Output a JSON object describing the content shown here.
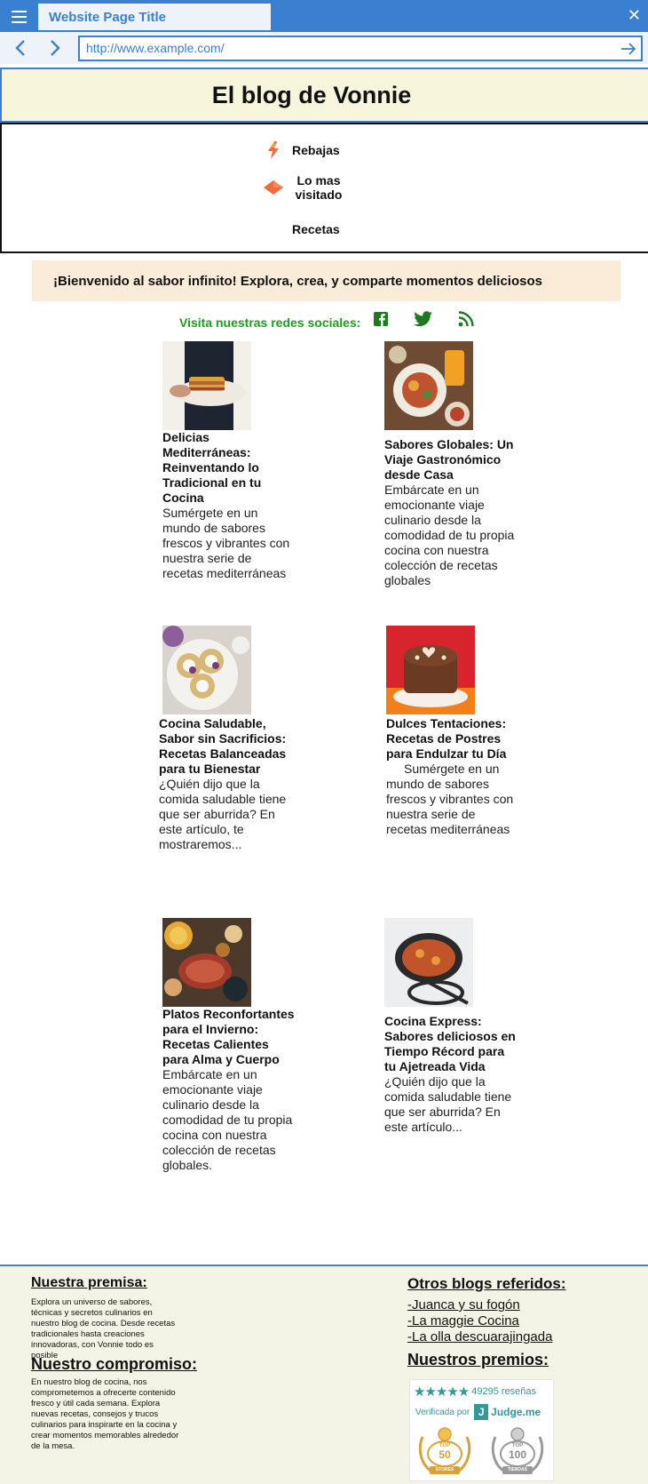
{
  "browser": {
    "tab_title": "Website Page Title",
    "url": "http://www.example.com/"
  },
  "header": {
    "title": "El blog de Vonnie"
  },
  "nav": {
    "items": [
      {
        "label": "Rebajas",
        "icon": "lightning-icon"
      },
      {
        "label": "Lo mas visitado",
        "icon": "diamond-icon"
      },
      {
        "label": "Recetas",
        "icon": ""
      }
    ]
  },
  "welcome": {
    "text": "¡Bienvenido al sabor infinito!  Explora, crea, y comparte momentos deliciosos"
  },
  "social": {
    "label": "Visita nuestras redes sociales:",
    "icons": [
      "facebook-icon",
      "twitter-icon",
      "rss-icon"
    ],
    "color": "#1e7a1e"
  },
  "articles": [
    {
      "title": "Delicias Mediterráneas: Reinventando lo Tradicional en tu Cocina",
      "text": "Sumérgete en un mundo de sabores frescos y vibrantes con nuestra serie de recetas mediterráneas"
    },
    {
      "title": "Sabores Globales: Un Viaje Gastronómico desde Casa",
      "text": "Embárcate en un emocionante viaje culinario desde la comodidad de tu propia cocina con nuestra colección de recetas globales"
    },
    {
      "title": "Cocina Saludable, Sabor sin Sacrificios: Recetas Balanceadas para tu Bienestar",
      "text": "¿Quién dijo que la comida saludable tiene que ser aburrida? En este artículo, te mostraremos..."
    },
    {
      "title": "Dulces Tentaciones: Recetas de Postres para Endulzar tu Día",
      "text": "Sumérgete en un mundo de sabores frescos y vibrantes con nuestra serie de recetas mediterráneas"
    },
    {
      "title": "Platos Reconfortantes para el Invierno: Recetas Calientes para Alma y Cuerpo",
      "text": "Embárcate en un emocionante viaje culinario desde la comodidad de tu propia cocina con nuestra colección de recetas globales."
    },
    {
      "title": "Cocina Express: Sabores deliciosos en Tiempo Récord para tu Ajetreada Vida",
      "text": "¿Quién dijo que la comida saludable tiene que ser aburrida? En este artículo..."
    }
  ],
  "footer": {
    "premise_title": "Nuestra premisa:",
    "premise_text": "Explora un universo de sabores, técnicas y secretos culinarios en nuestro blog de cocina. Desde recetas tradicionales hasta creaciones innovadoras, con Vonnie todo es posible",
    "commitment_title": "Nuestro compromiso:",
    "commitment_text": "En nuestro blog de cocina, nos comprometemos a ofrecerte contenido fresco y útil cada semana. Explora nuevas recetas, consejos y trucos culinarios para inspirarte en la cocina y crear momentos memorables alrededor de la mesa.",
    "referred_title": "Otros blogs referidos:",
    "referred_links": [
      "-Juanca y su fogón",
      "-La maggie Cocina",
      "-La olla descuarajingada"
    ],
    "awards_title": "Nuestros premios:",
    "awards": {
      "reviews": "49295 reseñas",
      "verified": "Verificada por",
      "brand": "Judge.me",
      "badge1_top": "TOP",
      "badge1_num": "50",
      "badge1_bottom": "STORES",
      "badge2_top": "TOP",
      "badge2_num": "100",
      "badge2_bottom": "TIENDAS"
    }
  },
  "colors": {
    "accent": "#3a7fd0",
    "header_bg": "#f7f6dc",
    "welcome_bg": "#fbecda",
    "footer_bg": "#f4f4e6",
    "social_green": "#1e9e1e"
  }
}
